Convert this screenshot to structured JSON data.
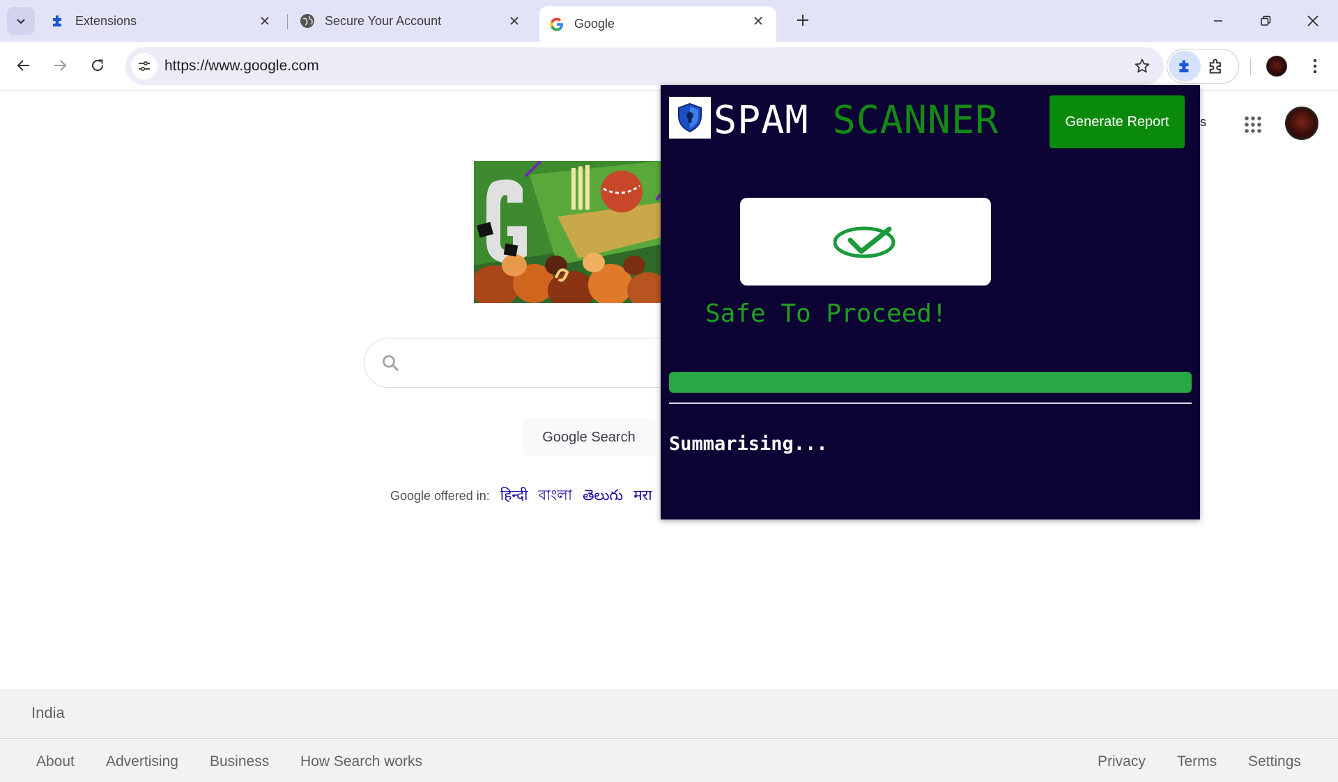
{
  "browser": {
    "tabs": [
      {
        "title": "Extensions",
        "icon": "puzzle-icon",
        "active": false
      },
      {
        "title": "Secure Your Account",
        "icon": "globe-icon",
        "active": false
      },
      {
        "title": "Google",
        "icon": "google-g-icon",
        "active": true
      }
    ],
    "url": "https://www.google.com"
  },
  "google": {
    "topright_partial": "es",
    "search_button": "Google Search",
    "offered_label": "Google offered in:",
    "languages": [
      "हिन्दी",
      "বাংলা",
      "తెలుగు",
      "मरा"
    ],
    "country": "India",
    "footer_left": [
      "About",
      "Advertising",
      "Business",
      "How Search works"
    ],
    "footer_right": [
      "Privacy",
      "Terms",
      "Settings"
    ]
  },
  "popup": {
    "title_word1": "SPAM",
    "title_word2": "SCANNER",
    "generate_button": "Generate Report",
    "result_text": "Safe To Proceed!",
    "progress": 1.0,
    "status_text": "Summarising...",
    "colors": {
      "background": "#0c0233",
      "accent_green": "#0a8a0a",
      "progress_green": "#28a745",
      "result_green": "#1ea01e"
    }
  }
}
